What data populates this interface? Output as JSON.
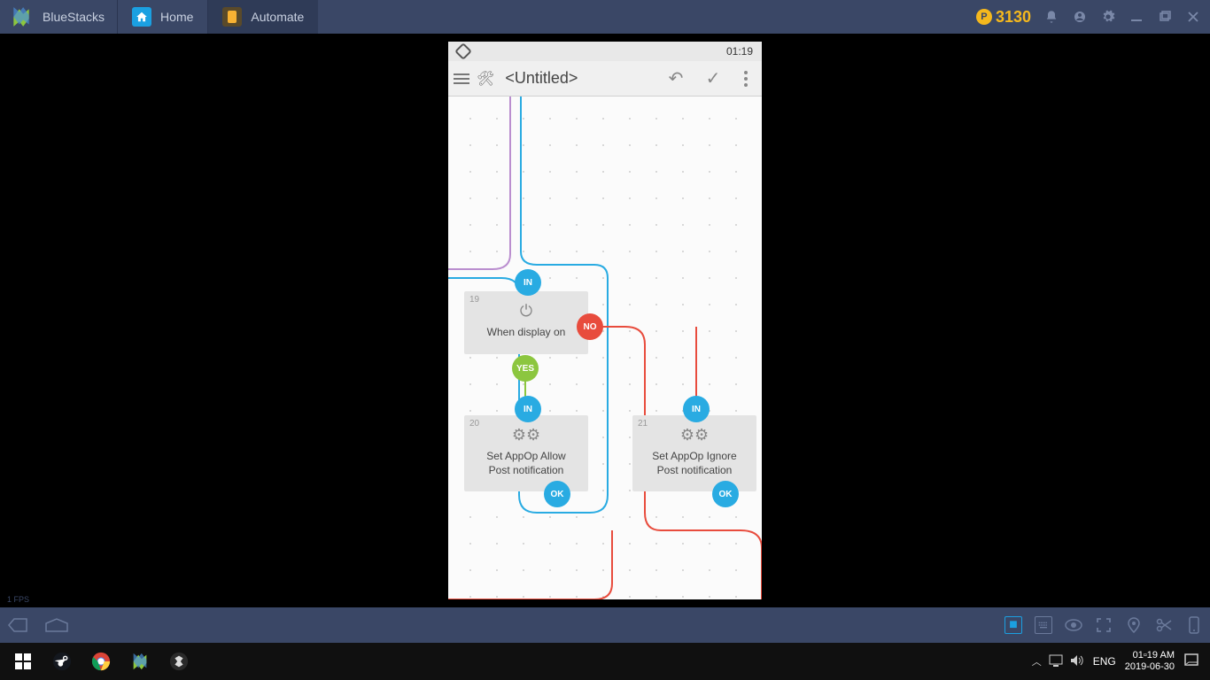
{
  "bluestacks": {
    "title": "BlueStacks",
    "tabs": [
      {
        "label": "Home"
      },
      {
        "label": "Automate"
      }
    ],
    "coins": "3130",
    "fps": "1 FPS"
  },
  "phone": {
    "status_time": "01:19"
  },
  "automate": {
    "title": "<Untitled>",
    "blocks": [
      {
        "num": "19",
        "label": "When display on"
      },
      {
        "num": "20",
        "label1": "Set AppOp Allow",
        "label2": "Post notification"
      },
      {
        "num": "21",
        "label1": "Set AppOp Ignore",
        "label2": "Post notification"
      }
    ],
    "badges": {
      "in": "IN",
      "ok": "OK",
      "yes": "YES",
      "no": "NO"
    }
  },
  "taskbar": {
    "lang": "ENG",
    "time": "01▫19 AM",
    "date": "2019-06-30"
  }
}
